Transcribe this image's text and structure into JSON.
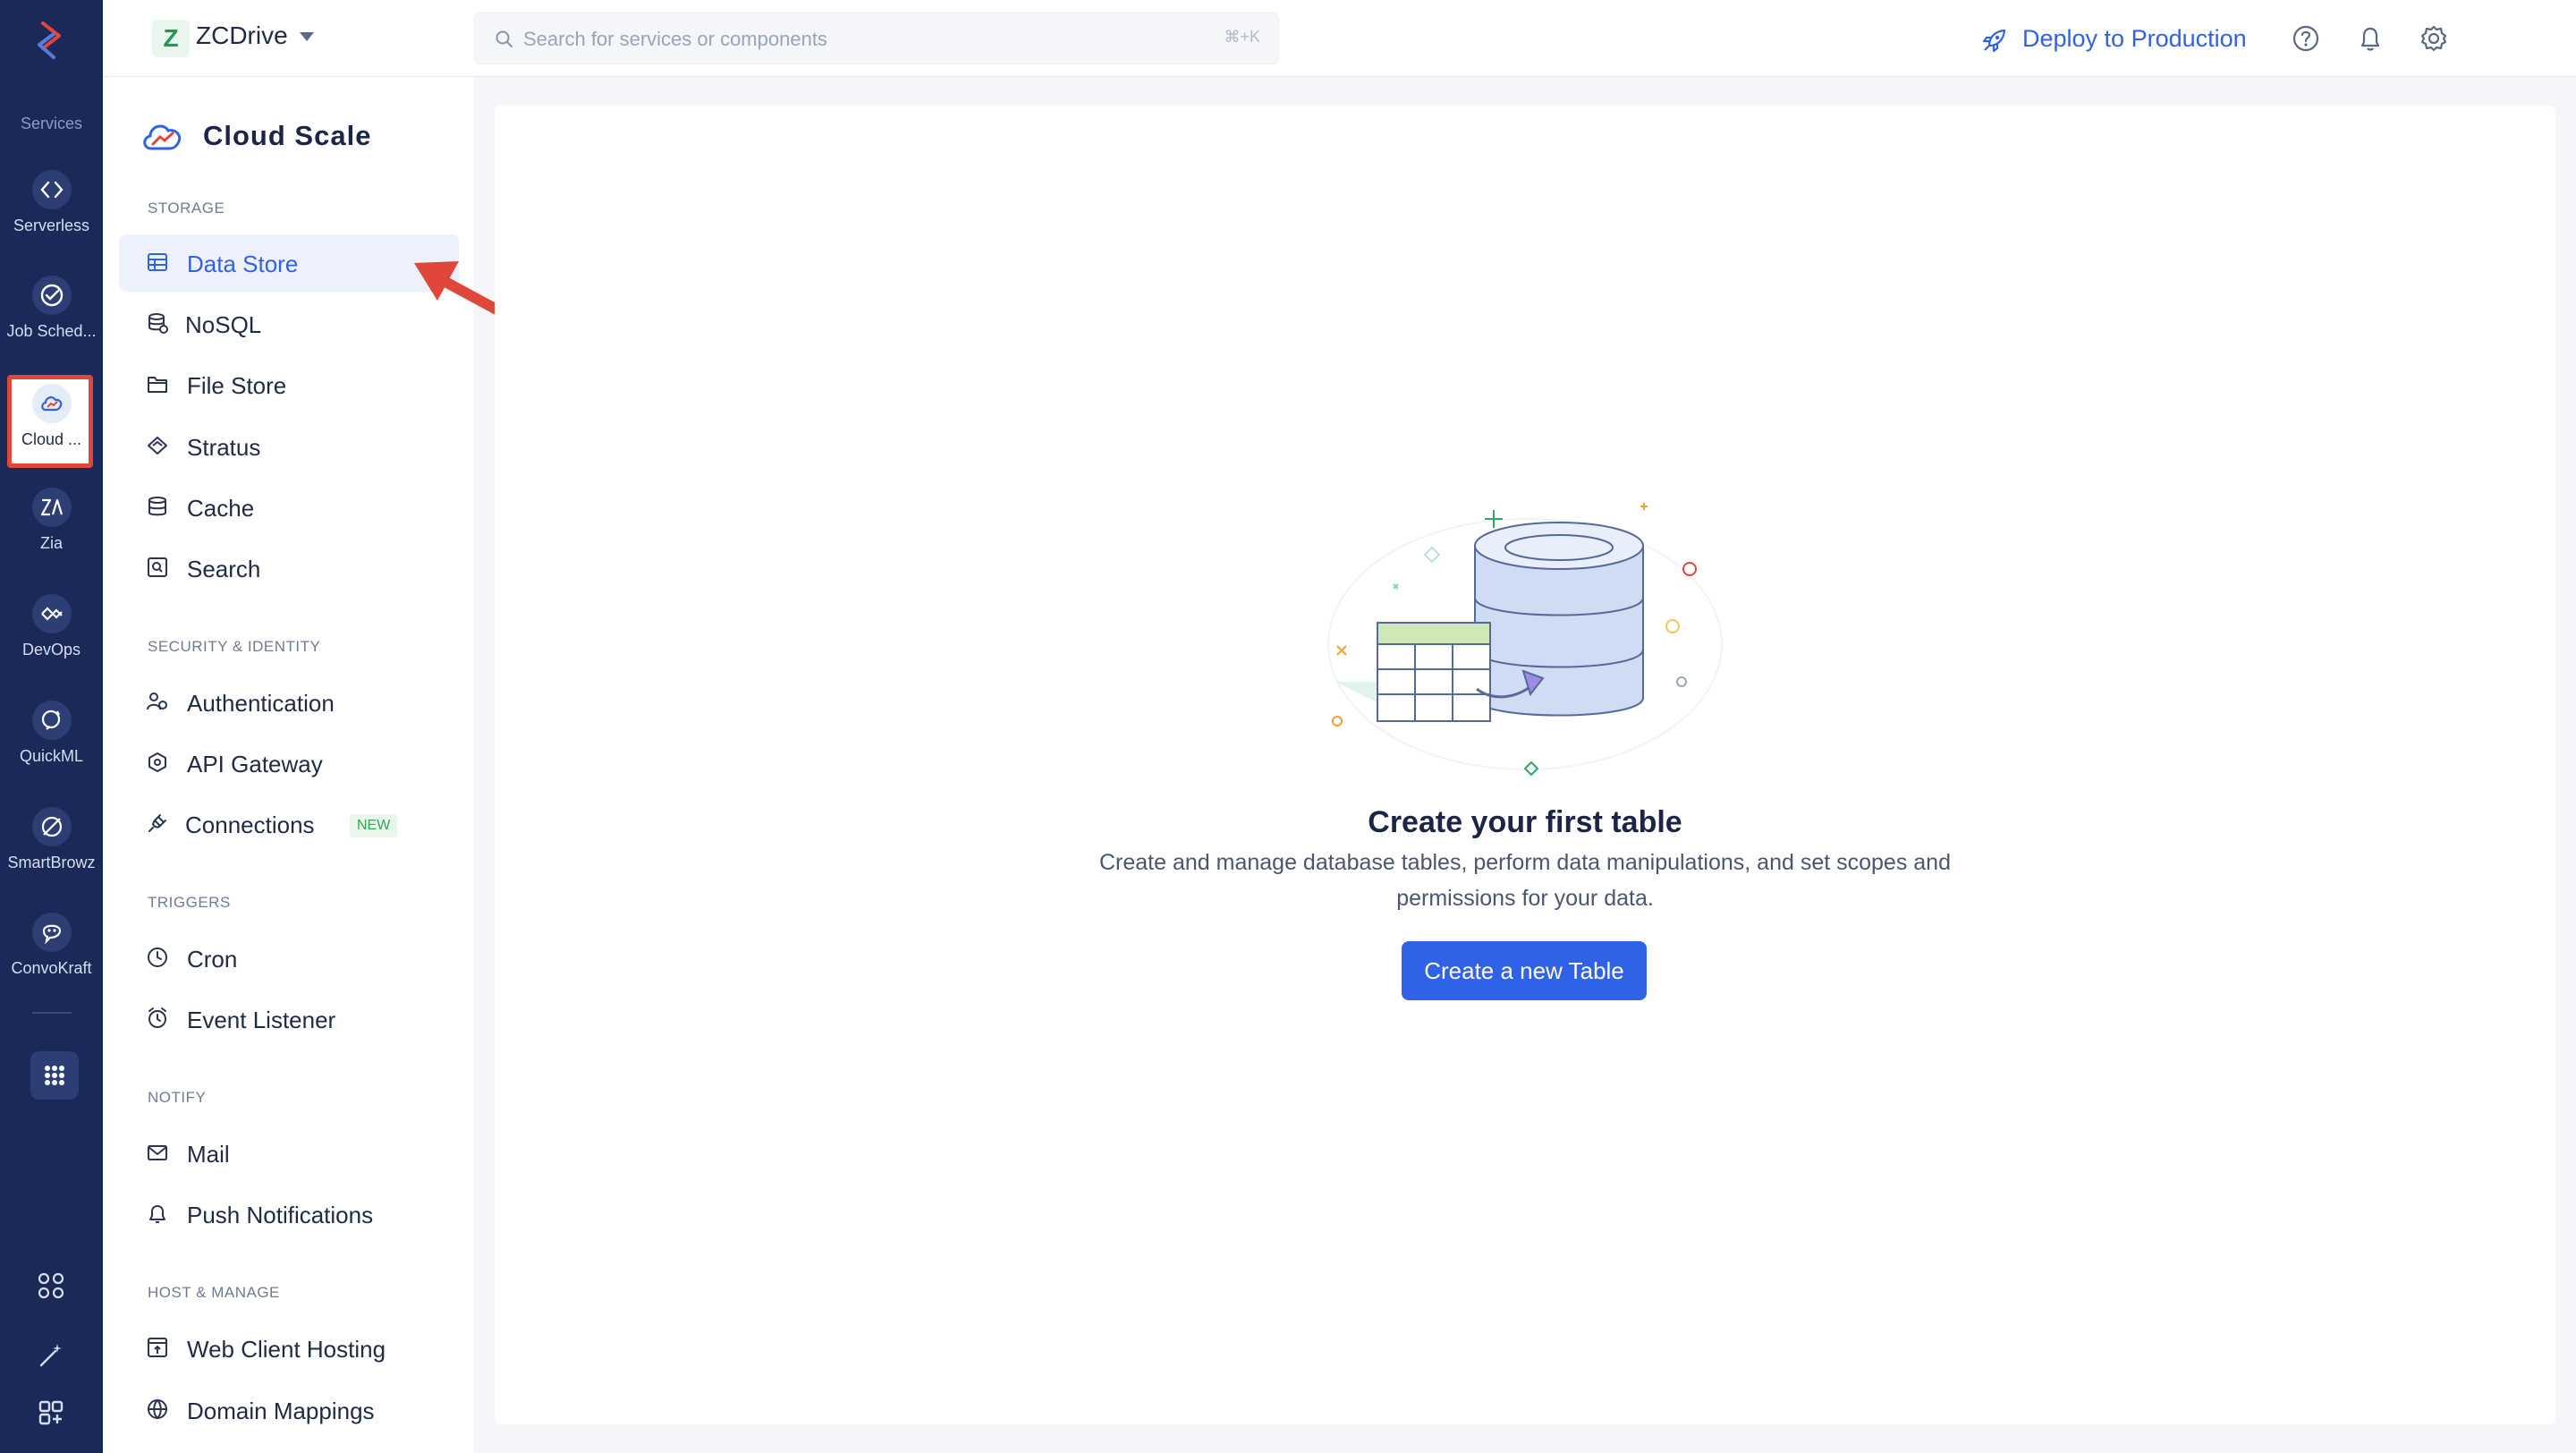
{
  "rail": {
    "services_label": "Services",
    "items": [
      {
        "label": "Serverless",
        "icon": "serverless-icon"
      },
      {
        "label": "Job Sched...",
        "icon": "job-scheduling-icon"
      },
      {
        "label": "Cloud ...",
        "icon": "cloud-scale-icon",
        "active": true
      },
      {
        "label": "Zia",
        "icon": "zia-icon"
      },
      {
        "label": "DevOps",
        "icon": "devops-icon"
      },
      {
        "label": "QuickML",
        "icon": "quickml-icon"
      },
      {
        "label": "SmartBrowz",
        "icon": "smartbrowz-icon"
      },
      {
        "label": "ConvoKraft",
        "icon": "convokraft-icon"
      }
    ]
  },
  "header": {
    "project_initial": "Z",
    "project_name": "ZCDrive",
    "search_placeholder": "Search for services or components",
    "search_shortcut": "⌘+K",
    "deploy_label": "Deploy to Production"
  },
  "subnav": {
    "title": "Cloud Scale",
    "sections": {
      "storage": "STORAGE",
      "security": "SECURITY & IDENTITY",
      "triggers": "TRIGGERS",
      "notify": "NOTIFY",
      "host": "HOST & MANAGE"
    },
    "items": {
      "data_store": "Data Store",
      "nosql": "NoSQL",
      "file_store": "File Store",
      "stratus": "Stratus",
      "cache": "Cache",
      "search": "Search",
      "authentication": "Authentication",
      "api_gateway": "API Gateway",
      "connections": "Connections",
      "connections_badge": "NEW",
      "cron": "Cron",
      "event_listener": "Event Listener",
      "mail": "Mail",
      "push_notifications": "Push Notifications",
      "web_client_hosting": "Web Client Hosting",
      "domain_mappings": "Domain Mappings"
    }
  },
  "main": {
    "empty_title": "Create your first table",
    "empty_description": "Create and manage database tables, perform data manipulations, and set scopes and permissions for your data.",
    "create_button": "Create a new Table"
  },
  "colors": {
    "rail_bg": "#1a2957",
    "accent": "#2f62e6",
    "annotation": "#e0463a"
  }
}
